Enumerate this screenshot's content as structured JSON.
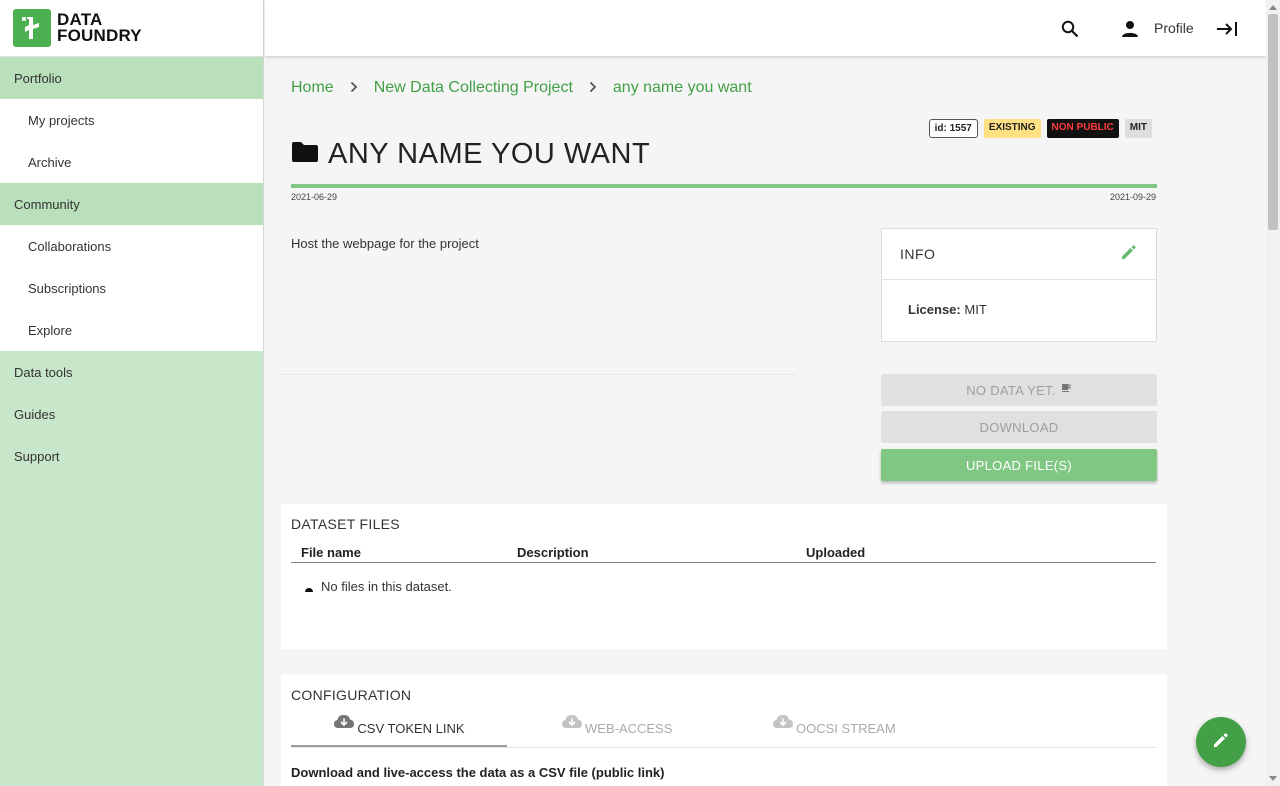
{
  "logo": {
    "line1": "DATA",
    "line2": "FOUNDRY"
  },
  "sidebar": {
    "items": [
      {
        "label": "Portfolio"
      },
      {
        "label": "My projects"
      },
      {
        "label": "Archive"
      },
      {
        "label": "Community"
      },
      {
        "label": "Collaborations"
      },
      {
        "label": "Subscriptions"
      },
      {
        "label": "Explore"
      },
      {
        "label": "Data tools"
      },
      {
        "label": "Guides"
      },
      {
        "label": "Support"
      }
    ]
  },
  "topbar": {
    "profile_label": "Profile"
  },
  "breadcrumb": [
    "Home",
    "New Data Collecting Project",
    "any name you want"
  ],
  "badges": {
    "id": "id: 1557",
    "status": "EXISTING",
    "visibility": "NON PUBLIC",
    "license": "MIT"
  },
  "project": {
    "title": "ANY NAME YOU WANT",
    "start_date": "2021-06-29",
    "end_date": "2021-09-29",
    "progress": 1.0,
    "description": "Host the webpage for the project"
  },
  "info": {
    "title": "INFO",
    "license_label": "License:",
    "license_value": "MIT"
  },
  "buttons": {
    "no_data": "NO DATA YET.",
    "download": "DOWNLOAD",
    "upload": "UPLOAD FILE(S)"
  },
  "dataset_files": {
    "title": "DATASET FILES",
    "columns": [
      "File name",
      "Description",
      "Uploaded"
    ],
    "empty_text": "No files in this dataset."
  },
  "configuration": {
    "title": "CONFIGURATION",
    "tabs": [
      "CSV TOKEN LINK",
      "WEB-ACCESS",
      "OOCSI STREAM"
    ],
    "active_tab": 0,
    "heading": "Download and live-access the data as a CSV file (public link)"
  },
  "colors": {
    "accent": "#43a047",
    "sidebar": "#c8e6c9",
    "progress": "#81c784"
  }
}
